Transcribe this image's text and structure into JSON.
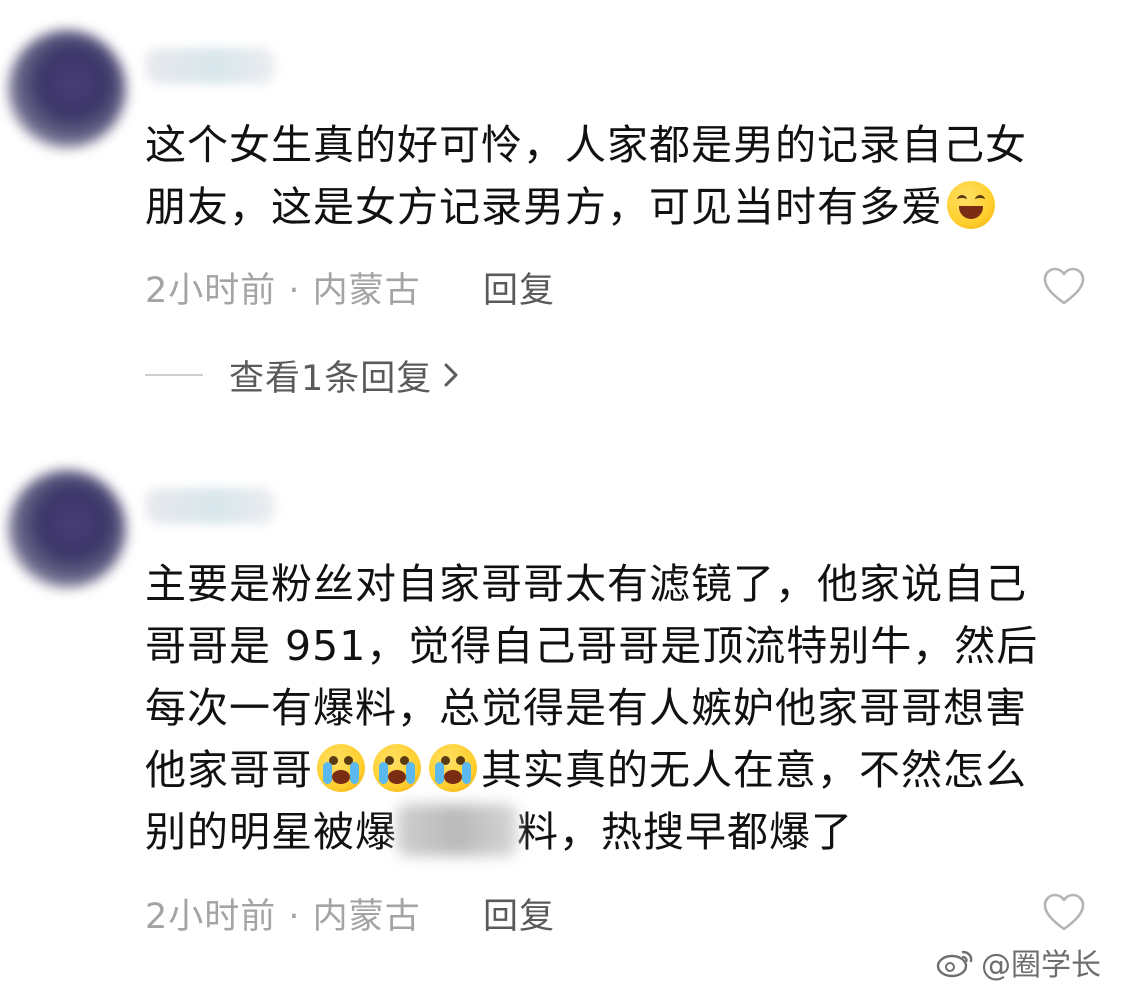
{
  "comments": [
    {
      "text_lines": [
        "这个女生真的好可怜，人家都是男的记录自己女",
        "朋友，这是女方记录男方，可见当时有多爱"
      ],
      "time": "2小时前",
      "location": "内蒙古",
      "meta": "2小时前 · 内蒙古",
      "reply_label": "回复",
      "view_replies_label": "查看1条回复",
      "emoji": "grinning-face"
    },
    {
      "text_lines": [
        "主要是粉丝对自家哥哥太有滤镜了，他家说自己",
        "哥哥是 951，觉得自己哥哥是顶流特别牛，然后",
        "每次一有爆料，总觉得是有人嫉妒他家哥哥想害",
        "他家哥哥",
        "其实真的无人在意，不然怎么",
        "别的明星被爆",
        "料，热搜早都爆了"
      ],
      "time": "2小时前",
      "location": "内蒙古",
      "meta": "2小时前 · 内蒙古",
      "reply_label": "回复",
      "emoji": "crying-face"
    }
  ],
  "watermark": "@圈学长",
  "colors": {
    "text": "#111111",
    "meta": "#a4a4a4",
    "action": "#5a5a5a"
  }
}
